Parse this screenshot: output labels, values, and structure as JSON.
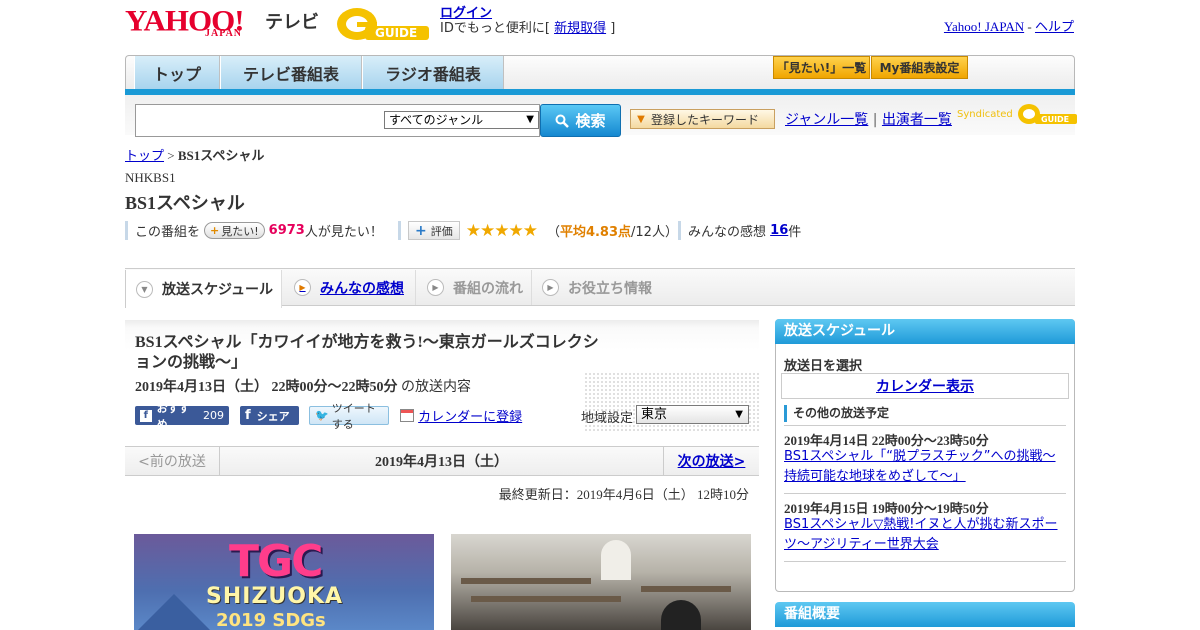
{
  "header": {
    "logo_yahoo": "YAHOO!",
    "logo_japan": "JAPAN",
    "logo_tv": "テレビ",
    "gguide_logo": "GUIDE",
    "login": "ログイン",
    "login_note_prefix": "IDでもっと便利に[",
    "register": "新規取得",
    "login_note_suffix": "]",
    "yahoo_japan": "Yahoo! JAPAN",
    "separator": "-",
    "help": "ヘルプ"
  },
  "nav": {
    "tabs": [
      "トップ",
      "テレビ番組表",
      "ラジオ番組表"
    ],
    "mitai_list": "「見たい!」一覧",
    "my_settings": "My番組表設定"
  },
  "search": {
    "genre_selected": "すべてのジャンル",
    "button": "検索",
    "keyword_button": "登録したキーワード",
    "genre_list": "ジャンル一覧",
    "divider": "|",
    "performer_list": "出演者一覧",
    "syndicated": "Syndicated",
    "syndicated_logo": "GUIDE"
  },
  "breadcrumb": {
    "top": "トップ",
    "sep": ">",
    "current": "BS1スペシャル"
  },
  "program": {
    "channel": "NHKBS1",
    "title": "BS1スペシャル",
    "mitai_prefix": "この番組を",
    "mitai_button": "見たい!",
    "mitai_count": "6973",
    "mitai_suffix": "人が見たい！",
    "hyoka_button": "評価",
    "rating": 4.83,
    "rating_stars": "★★★★★",
    "rating_open": "（",
    "rating_avg": "平均4.83点",
    "rating_people": "/12人）",
    "kansou_prefix": "みんなの感想",
    "kansou_count": "16",
    "kansou_suffix": "件"
  },
  "tabs": {
    "schedule": "放送スケジュール",
    "kansou": "みんなの感想",
    "flow": "番組の流れ",
    "info": "お役立ち情報"
  },
  "episode": {
    "title": "BS1スペシャル「カワイイが地方を救う!～東京ガールズコレクションの挑戦～」",
    "datetime": "2019年4月13日（土）  22時00分～22時50分",
    "datetime_suffix": "の放送内容",
    "fb_recommend": "おすすめ",
    "fb_count": "209",
    "fb_share": "シェア",
    "tweet": "ツイートする",
    "calendar_register": "カレンダーに登録",
    "region_label": "地域設定",
    "region_selected": "東京"
  },
  "pager": {
    "prev": "<前の放送",
    "date": "2019年4月13日（土）",
    "next": "次の放送>"
  },
  "updated": "最終更新日：2019年4月6日（土）  12時10分",
  "images": {
    "img1_tgc": "TGC",
    "img1_shizuoka": "SHIZUOKA",
    "img1_sdgs": "2019 SDGs"
  },
  "sidebar": {
    "schedule_head": "放送スケジュール",
    "select_date": "放送日を選択",
    "calendar_view": "カレンダー表示",
    "other_head": "その他の放送予定",
    "items": [
      {
        "date": "2019年4月14日  22時00分～23時50分",
        "title": "BS1スペシャル「“脱プラスチック”への挑戦～持続可能な地球をめざして～」"
      },
      {
        "date": "2019年4月15日  19時00分～19時50分",
        "title": "BS1スペシャル▽熱戦!イヌと人が挑む新スポーツ～アジリティー世界大会"
      }
    ],
    "overview_head": "番組概要"
  },
  "colors": {
    "accent_blue": "#1a9ad6",
    "yahoo_red": "#e6002d",
    "pink_count": "#e6005c",
    "rating_orange": "#e08000"
  }
}
